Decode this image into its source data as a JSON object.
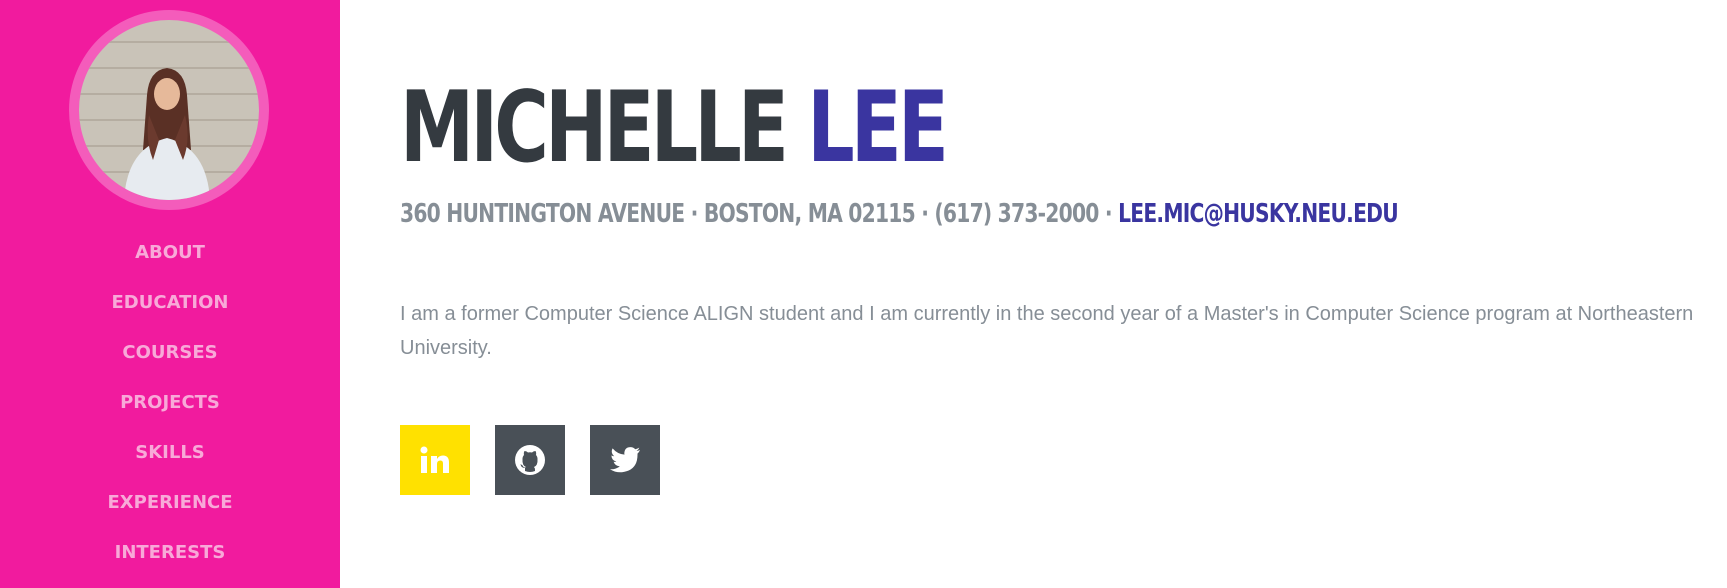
{
  "profile": {
    "photo_icon": "profile-photo",
    "first_name": "MICHELLE",
    "last_name": "LEE",
    "address": "360 Huntington Avenue · Boston, MA 02115 · (617) 373-2000 · ",
    "email": "lee.mic@husky.neu.edu",
    "bio": "I am a former Computer Science ALIGN student and I am currently in the second year of a Master's in Computer Science program at Northeastern University."
  },
  "sidebar": {
    "items": [
      {
        "label": "About"
      },
      {
        "label": "Education"
      },
      {
        "label": "Courses"
      },
      {
        "label": "Projects"
      },
      {
        "label": "Skills"
      },
      {
        "label": "Experience"
      },
      {
        "label": "Interests"
      }
    ]
  },
  "social": [
    {
      "icon": "linkedin-icon"
    },
    {
      "icon": "github-icon"
    },
    {
      "icon": "twitter-icon"
    }
  ],
  "colors": {
    "sidebar": "#f11b9e",
    "nav_text": "#f8a9d8",
    "accent": "#3a35a0",
    "heading": "#343a40",
    "muted": "#868e96",
    "linkedin_bg": "#ffe100",
    "social_bg": "#495057"
  }
}
